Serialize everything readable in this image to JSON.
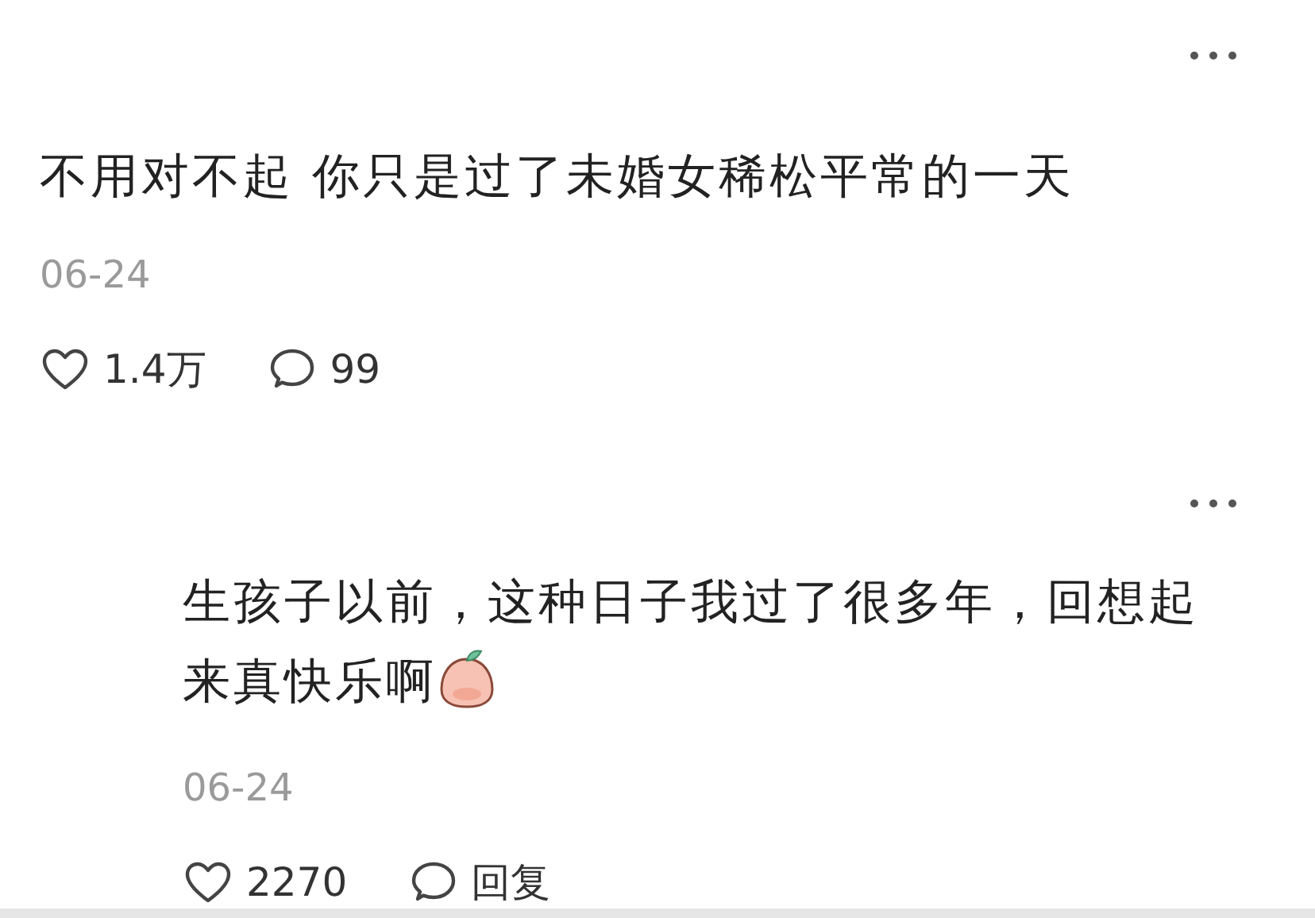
{
  "comments": [
    {
      "kind": "comment",
      "text": "不用对不起 你只是过了未婚女稀松平常的一天",
      "sticker": false,
      "date": "06-24",
      "likes": "1.4万",
      "replies": "99"
    },
    {
      "kind": "reply",
      "text": "生孩子以前，这种日子我过了很多年，回想起来真快乐啊",
      "sticker": true,
      "date": "06-24",
      "likes": "2270",
      "replies": "回复"
    }
  ]
}
